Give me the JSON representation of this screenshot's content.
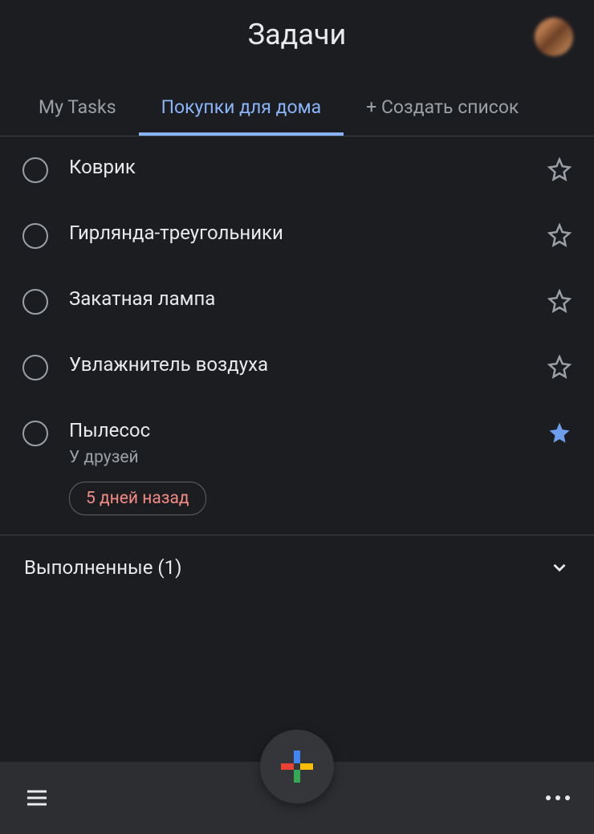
{
  "header": {
    "title": "Задачи",
    "avatar_name": "user-avatar"
  },
  "tabs": [
    {
      "label": "My Tasks",
      "active": false
    },
    {
      "label": "Покупки для дома",
      "active": true
    },
    {
      "label": "+ Создать список",
      "active": false
    }
  ],
  "tasks": [
    {
      "title": "Коврик",
      "subtitle": "",
      "chip": "",
      "starred": false
    },
    {
      "title": "Гирлянда-треугольники",
      "subtitle": "",
      "chip": "",
      "starred": false
    },
    {
      "title": "Закатная лампа",
      "subtitle": "",
      "chip": "",
      "starred": false
    },
    {
      "title": "Увлажнитель воздуха",
      "subtitle": "",
      "chip": "",
      "starred": false
    },
    {
      "title": "Пылесос",
      "subtitle": "У друзей",
      "chip": "5 дней назад",
      "starred": true
    }
  ],
  "completed": {
    "label": "Выполненные (1)"
  }
}
